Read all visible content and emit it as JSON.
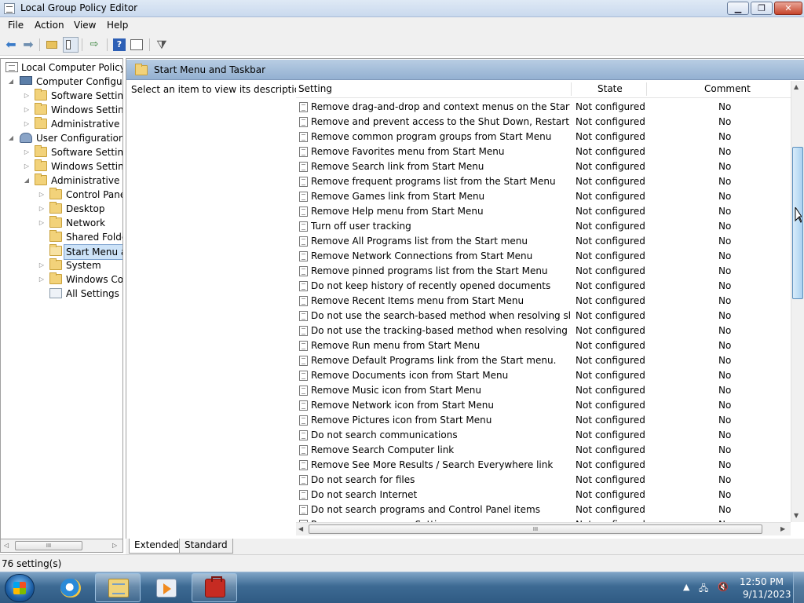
{
  "window": {
    "title": "Local Group Policy Editor",
    "min_label": "▁",
    "max_label": "❐",
    "close_label": "✕"
  },
  "menubar": [
    "File",
    "Action",
    "View",
    "Help"
  ],
  "toolbar": {
    "icons": [
      "back-arrow-icon",
      "forward-arrow-icon",
      "up-folder-icon",
      "show-hide-tree-icon",
      "export-list-icon",
      "help-icon",
      "properties-icon",
      "filter-icon"
    ]
  },
  "tree": {
    "nodes": [
      {
        "label": "Local Computer Policy",
        "level": 0,
        "icon": "policy-doc-icon",
        "expander": ""
      },
      {
        "label": "Computer Configura",
        "level": 1,
        "icon": "computer-icon",
        "expander": "◢"
      },
      {
        "label": "Software Settings",
        "level": 2,
        "icon": "folder-icon",
        "expander": "▷"
      },
      {
        "label": "Windows Setting",
        "level": 2,
        "icon": "folder-icon",
        "expander": "▷"
      },
      {
        "label": "Administrative Te",
        "level": 2,
        "icon": "folder-icon",
        "expander": "▷"
      },
      {
        "label": "User Configuration",
        "level": 1,
        "icon": "user-icon",
        "expander": "◢"
      },
      {
        "label": "Software Settings",
        "level": 2,
        "icon": "folder-icon",
        "expander": "▷"
      },
      {
        "label": "Windows Setting",
        "level": 2,
        "icon": "folder-icon",
        "expander": "▷"
      },
      {
        "label": "Administrative Te",
        "level": 2,
        "icon": "folder-icon",
        "expander": "◢"
      },
      {
        "label": "Control Panel",
        "level": 3,
        "icon": "folder-icon",
        "expander": "▷"
      },
      {
        "label": "Desktop",
        "level": 3,
        "icon": "folder-icon",
        "expander": "▷"
      },
      {
        "label": "Network",
        "level": 3,
        "icon": "folder-icon",
        "expander": "▷"
      },
      {
        "label": "Shared Folder",
        "level": 3,
        "icon": "folder-icon",
        "expander": ""
      },
      {
        "label": "Start Menu ar",
        "level": 3,
        "icon": "folder-open-icon",
        "expander": "",
        "selected": true
      },
      {
        "label": "System",
        "level": 3,
        "icon": "folder-icon",
        "expander": "▷"
      },
      {
        "label": "Windows Cor",
        "level": 3,
        "icon": "folder-icon",
        "expander": "▷"
      },
      {
        "label": "All Settings",
        "level": 3,
        "icon": "all-settings-icon",
        "expander": ""
      }
    ],
    "scroll_left": "◁",
    "scroll_right": "▷",
    "scroll_grip": "III"
  },
  "details": {
    "header": "Start Menu and Taskbar",
    "description": "Select an item to view its description.",
    "columns": {
      "setting": "Setting",
      "state": "State",
      "comment": "Comment"
    },
    "rows": [
      {
        "name": "Remove drag-and-drop and context menus on the Start Me...",
        "state": "Not configured",
        "comment": "No"
      },
      {
        "name": "Remove and prevent access to the Shut Down, Restart, Sleep...",
        "state": "Not configured",
        "comment": "No"
      },
      {
        "name": "Remove common program groups from Start Menu",
        "state": "Not configured",
        "comment": "No"
      },
      {
        "name": "Remove Favorites menu from Start Menu",
        "state": "Not configured",
        "comment": "No"
      },
      {
        "name": "Remove Search link from Start Menu",
        "state": "Not configured",
        "comment": "No"
      },
      {
        "name": "Remove frequent programs list from the Start Menu",
        "state": "Not configured",
        "comment": "No"
      },
      {
        "name": "Remove Games link from Start Menu",
        "state": "Not configured",
        "comment": "No"
      },
      {
        "name": "Remove Help menu from Start Menu",
        "state": "Not configured",
        "comment": "No"
      },
      {
        "name": "Turn off user tracking",
        "state": "Not configured",
        "comment": "No"
      },
      {
        "name": "Remove All Programs list from the Start menu",
        "state": "Not configured",
        "comment": "No"
      },
      {
        "name": "Remove Network Connections from Start Menu",
        "state": "Not configured",
        "comment": "No"
      },
      {
        "name": "Remove pinned programs list from the Start Menu",
        "state": "Not configured",
        "comment": "No"
      },
      {
        "name": "Do not keep history of recently opened documents",
        "state": "Not configured",
        "comment": "No"
      },
      {
        "name": "Remove Recent Items menu from Start Menu",
        "state": "Not configured",
        "comment": "No"
      },
      {
        "name": "Do not use the search-based method when resolving shell s...",
        "state": "Not configured",
        "comment": "No"
      },
      {
        "name": "Do not use the tracking-based method when resolving shell ...",
        "state": "Not configured",
        "comment": "No"
      },
      {
        "name": "Remove Run menu from Start Menu",
        "state": "Not configured",
        "comment": "No"
      },
      {
        "name": "Remove Default Programs link from the Start menu.",
        "state": "Not configured",
        "comment": "No"
      },
      {
        "name": "Remove Documents icon from Start Menu",
        "state": "Not configured",
        "comment": "No"
      },
      {
        "name": "Remove Music icon from Start Menu",
        "state": "Not configured",
        "comment": "No"
      },
      {
        "name": "Remove Network icon from Start Menu",
        "state": "Not configured",
        "comment": "No"
      },
      {
        "name": "Remove Pictures icon from Start Menu",
        "state": "Not configured",
        "comment": "No"
      },
      {
        "name": "Do not search communications",
        "state": "Not configured",
        "comment": "No"
      },
      {
        "name": "Remove Search Computer link",
        "state": "Not configured",
        "comment": "No"
      },
      {
        "name": "Remove See More Results / Search Everywhere link",
        "state": "Not configured",
        "comment": "No"
      },
      {
        "name": "Do not search for files",
        "state": "Not configured",
        "comment": "No"
      },
      {
        "name": "Do not search Internet",
        "state": "Not configured",
        "comment": "No"
      },
      {
        "name": "Do not search programs and Control Panel items",
        "state": "Not configured",
        "comment": "No"
      },
      {
        "name": "Remove programs on Settings menu",
        "state": "Not configured",
        "comment": "No"
      }
    ],
    "scroll_up": "▲",
    "scroll_down": "▼",
    "scroll_left": "◀",
    "scroll_right": "▶",
    "scroll_grip": "III"
  },
  "view_tabs": {
    "extended": "Extended",
    "standard": "Standard"
  },
  "status": {
    "text": "76 setting(s)"
  },
  "taskbar": {
    "buttons": [
      "internet-explorer-icon",
      "windows-explorer-icon",
      "media-player-icon",
      "toolbox-icon"
    ],
    "tray": {
      "show_hidden": "▲",
      "network": "🖧",
      "volume": "🔇",
      "time": "12:50 PM",
      "date": "9/11/2023"
    }
  },
  "colors": {
    "accent": "#3399ff",
    "pane_header": "#a7c0dc",
    "taskbar": "#3d6a93"
  }
}
